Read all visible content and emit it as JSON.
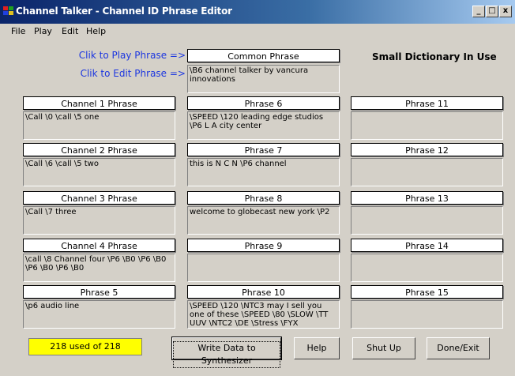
{
  "window": {
    "title": "Channel Talker - Channel ID Phrase Editor",
    "minimize": "_",
    "maximize": "□",
    "close": "x"
  },
  "menu": [
    "File",
    "Play",
    "Edit",
    "Help"
  ],
  "labels": {
    "play_hint": "Clik to Play Phrase =>",
    "edit_hint": "Clik to Edit Phrase =>",
    "dictionary": "Small Dictionary In Use"
  },
  "common": {
    "label": "Common Phrase",
    "text": "\\B6 channel talker by vancura innovations"
  },
  "phrases": [
    {
      "label": "Channel 1 Phrase",
      "text": "\\Call \\0 \\call \\5 one"
    },
    {
      "label": "Channel 2 Phrase",
      "text": "\\Call \\6 \\call \\5 two"
    },
    {
      "label": "Channel 3 Phrase",
      "text": "\\Call \\7 three"
    },
    {
      "label": "Channel 4 Phrase",
      "text": "\\call \\8 Channel four \\P6 \\B0 \\P6 \\B0 \\P6 \\B0 \\P6 \\B0"
    },
    {
      "label": "Phrase 5",
      "text": "\\p6 audio line"
    },
    {
      "label": "Phrase 6",
      "text": "\\SPEED \\120 leading edge studios \\P6 L A city center"
    },
    {
      "label": "Phrase 7",
      "text": "this is N C N \\P6 channel"
    },
    {
      "label": "Phrase 8",
      "text": "welcome to globecast new york \\P2"
    },
    {
      "label": "Phrase 9",
      "text": ""
    },
    {
      "label": "Phrase 10",
      "text": "\\SPEED \\120 \\NTC3 may I sell you one of these \\SPEED \\80 \\SLOW \\TT UUV \\NTC2 \\DE \\Stress \\FYX"
    },
    {
      "label": "Phrase 11",
      "text": ""
    },
    {
      "label": "Phrase 12",
      "text": ""
    },
    {
      "label": "Phrase 13",
      "text": ""
    },
    {
      "label": "Phrase 14",
      "text": ""
    },
    {
      "label": "Phrase 15",
      "text": ""
    }
  ],
  "status": {
    "counter": "218 used of 218"
  },
  "buttons": {
    "write": "Write Data to Synthesizer",
    "help": "Help",
    "shutup": "Shut Up",
    "done": "Done/Exit"
  },
  "colors": {
    "title_start": "#0a246a",
    "title_end": "#a6caf0",
    "hint_blue": "#1c36e0",
    "counter_bg": "#ffff00",
    "face": "#d4d0c8"
  }
}
